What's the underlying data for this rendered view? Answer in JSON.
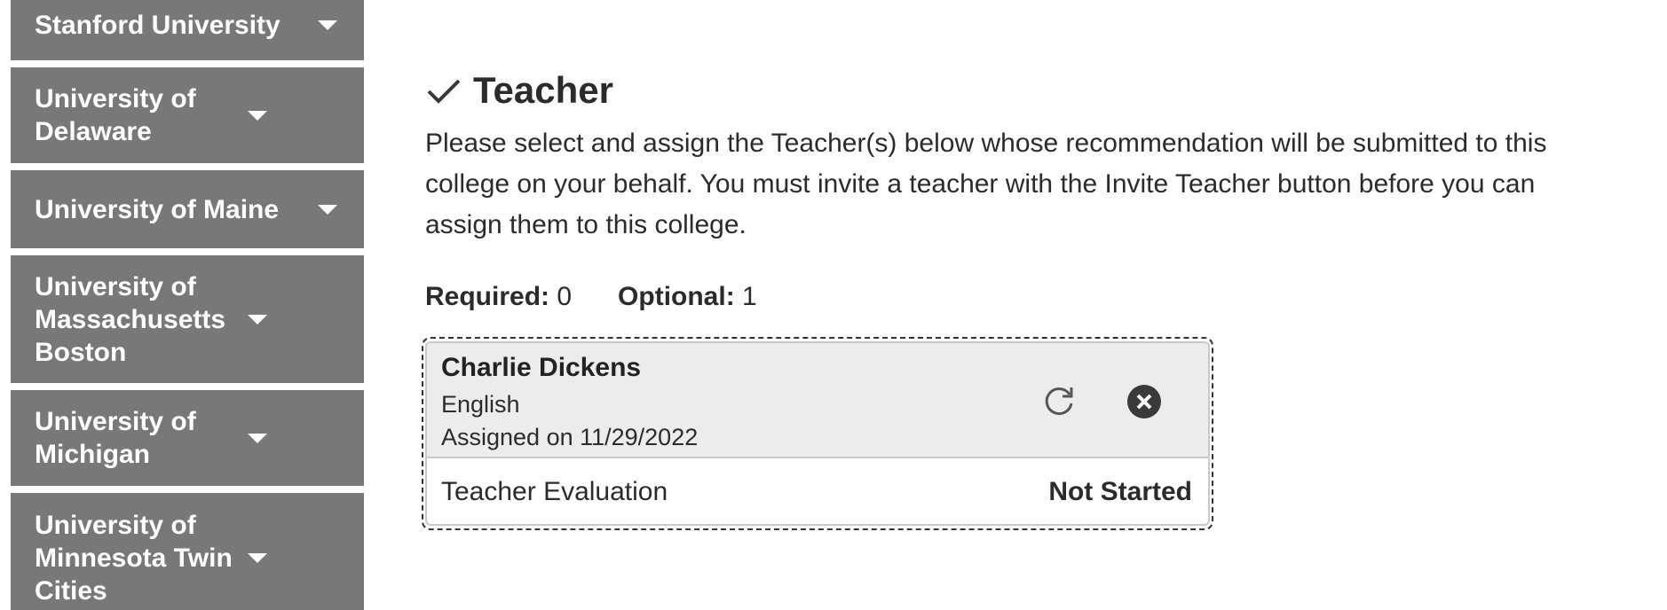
{
  "sidebar": {
    "items": [
      {
        "label": "Stanford University"
      },
      {
        "label": "University of Delaware"
      },
      {
        "label": "University of Maine"
      },
      {
        "label": "University of Massachusetts Boston"
      },
      {
        "label": "University of Michigan"
      },
      {
        "label": "University of Minnesota Twin Cities"
      }
    ]
  },
  "main": {
    "section_title": "Teacher",
    "description": "Please select and assign the Teacher(s) below whose recommendation will be submitted to this college on your behalf. You must invite a teacher with the Invite Teacher button before you can assign them to this college.",
    "counts": {
      "required_label": "Required:",
      "required_value": "0",
      "optional_label": "Optional:",
      "optional_value": "1"
    },
    "card": {
      "name": "Charlie Dickens",
      "subject": "English",
      "assigned": "Assigned on 11/29/2022",
      "evaluation_label": "Teacher Evaluation",
      "evaluation_status": "Not Started"
    }
  },
  "colors": {
    "sidebar_bg": "#787878",
    "sidebar_text": "#ffffff",
    "card_header_bg": "#ececec"
  },
  "icons": {
    "check": "check-icon",
    "refresh": "refresh-icon",
    "remove": "close-circle-icon",
    "caret": "chevron-down-icon"
  }
}
